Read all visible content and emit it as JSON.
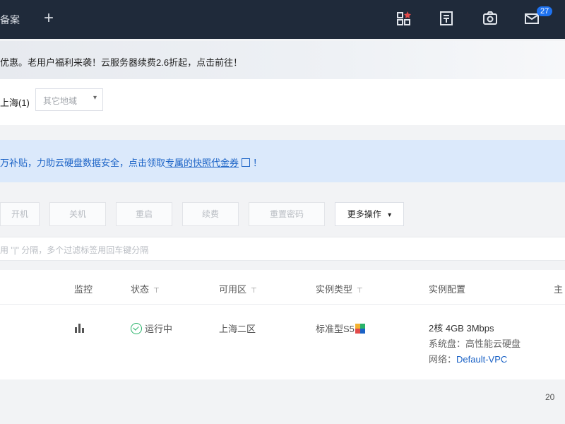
{
  "topbar": {
    "tab_label": "备案",
    "new_tab_symbol": "+",
    "notification_count": "27",
    "icons": [
      "grid-star-icon",
      "billing-icon",
      "camera-icon",
      "mail-icon"
    ]
  },
  "promo": {
    "text": "优惠。老用户福利来袭！云服务器续费2.6折起，点击前往！"
  },
  "region": {
    "name": "上海(1)",
    "tag_placeholder": "其它地域",
    "arrow": "▾"
  },
  "notice": {
    "prefix": "万补贴，力助云硬盘数据安全，点击领取",
    "link": "专属的快照代金券",
    "suffix": "！"
  },
  "toolbar": {
    "buttons": [
      "开机",
      "关机",
      "重启",
      "续费",
      "重置密码"
    ],
    "more_label": "更多操作",
    "more_arrow": "▾"
  },
  "search": {
    "placeholder": "用 \"|\" 分隔，多个过滤标签用回车键分隔"
  },
  "table": {
    "headers": {
      "monitor": "监控",
      "status": "状态",
      "zone": "可用区",
      "instance_type": "实例类型",
      "config": "实例配置",
      "more": "主"
    },
    "filter_symbol": "⊤",
    "row": {
      "status": "运行中",
      "zone": "上海二区",
      "instance_type": "标准型S5",
      "config_spec": "2核 4GB 3Mbps",
      "system_disk_label": "系统盘：",
      "system_disk_value": "高性能云硬盘",
      "network_label": "网络：",
      "network_value": "Default-VPC"
    }
  },
  "pagination": {
    "page_size": "20"
  },
  "colors": {
    "topbar": "#1f2a3a",
    "accent": "#1a62c6",
    "running": "#29b36a"
  }
}
